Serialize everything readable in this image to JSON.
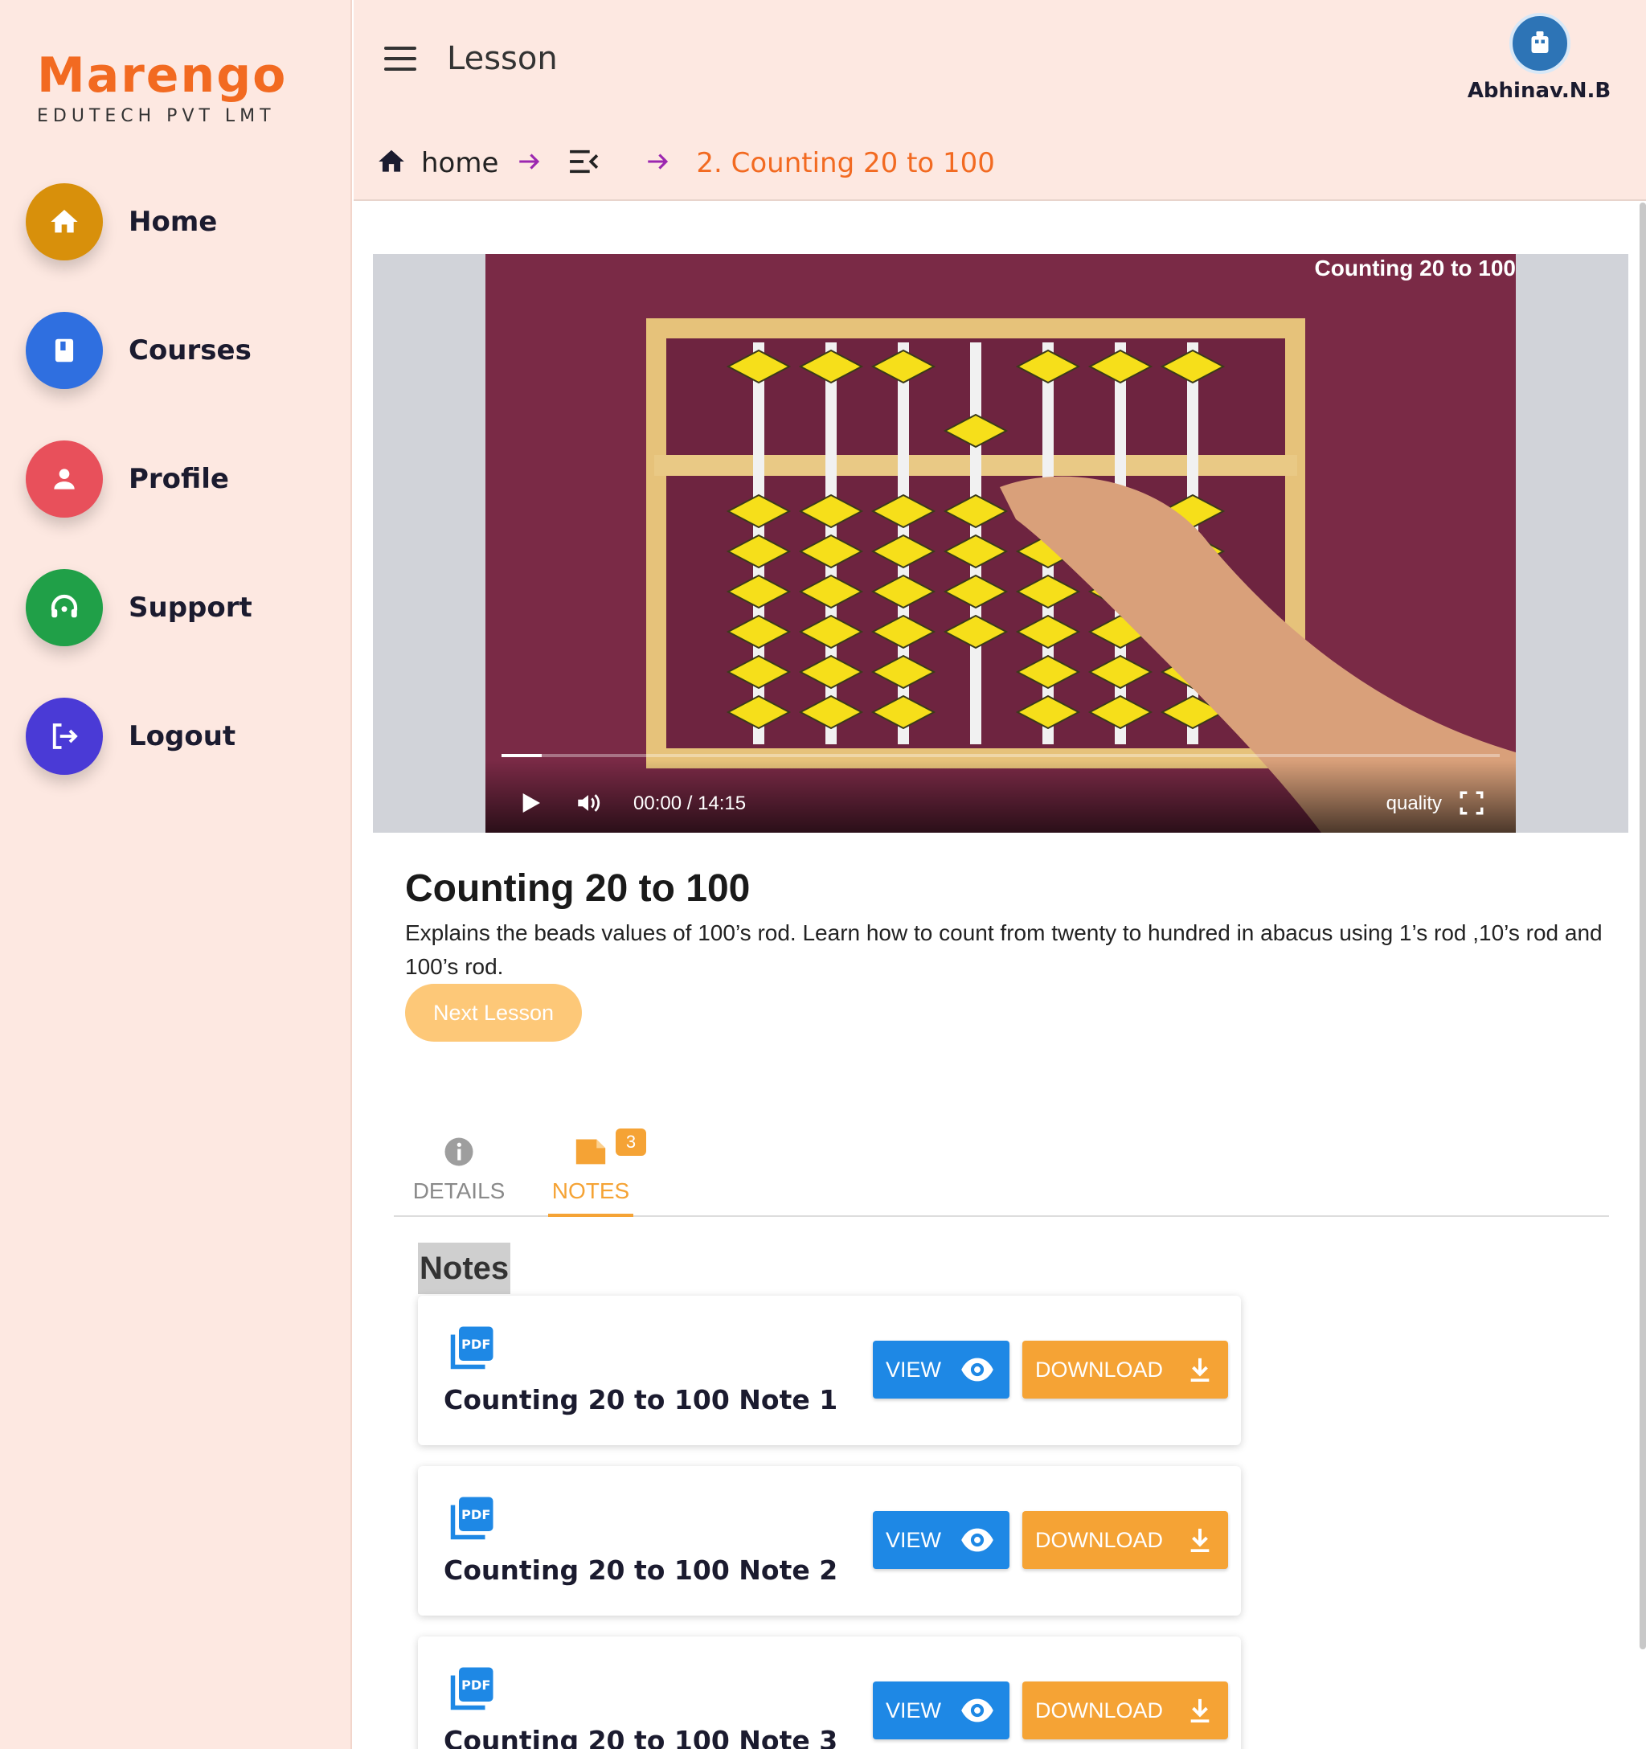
{
  "brand": {
    "name": "Marengo",
    "subtitle": "EDUTECH PVT LMT"
  },
  "sidebar": {
    "items": [
      {
        "label": "Home",
        "icon": "home-icon",
        "color": "#d8900b"
      },
      {
        "label": "Courses",
        "icon": "book-icon",
        "color": "#2f6fe0"
      },
      {
        "label": "Profile",
        "icon": "person-icon",
        "color": "#e8505b"
      },
      {
        "label": "Support",
        "icon": "headset-icon",
        "color": "#20a048"
      },
      {
        "label": "Logout",
        "icon": "logout-icon",
        "color": "#4a3ad6"
      }
    ]
  },
  "header": {
    "title": "Lesson",
    "user_name": "Abhinav.N.B",
    "breadcrumb": {
      "home": "home",
      "current": "2. Counting 20 to 100"
    }
  },
  "video": {
    "title_overlay": "Counting 20 to 100",
    "time": "00:00 / 14:15",
    "quality_label": "quality",
    "progress": 0.04
  },
  "lesson": {
    "title": "Counting 20 to 100",
    "description": "Explains the beads values of 100’s rod. Learn how to count from twenty to hundred in abacus using 1’s rod ,10’s rod and 100’s rod.",
    "next_label": "Next Lesson"
  },
  "tabs": {
    "details_label": "DETAILS",
    "notes_label": "NOTES",
    "notes_badge": "3",
    "active": "notes"
  },
  "notes": {
    "heading": "Notes",
    "view_label": "VIEW",
    "download_label": "DOWNLOAD",
    "items": [
      {
        "title": "Counting 20 to 100 Note 1"
      },
      {
        "title": "Counting 20 to 100 Note 2"
      },
      {
        "title": "Counting 20 to 100 Note 3"
      }
    ]
  },
  "colors": {
    "accent": "#f26a21",
    "sidebar_bg": "#fde8e1",
    "view": "#1e88e5",
    "download": "#f5a335"
  }
}
